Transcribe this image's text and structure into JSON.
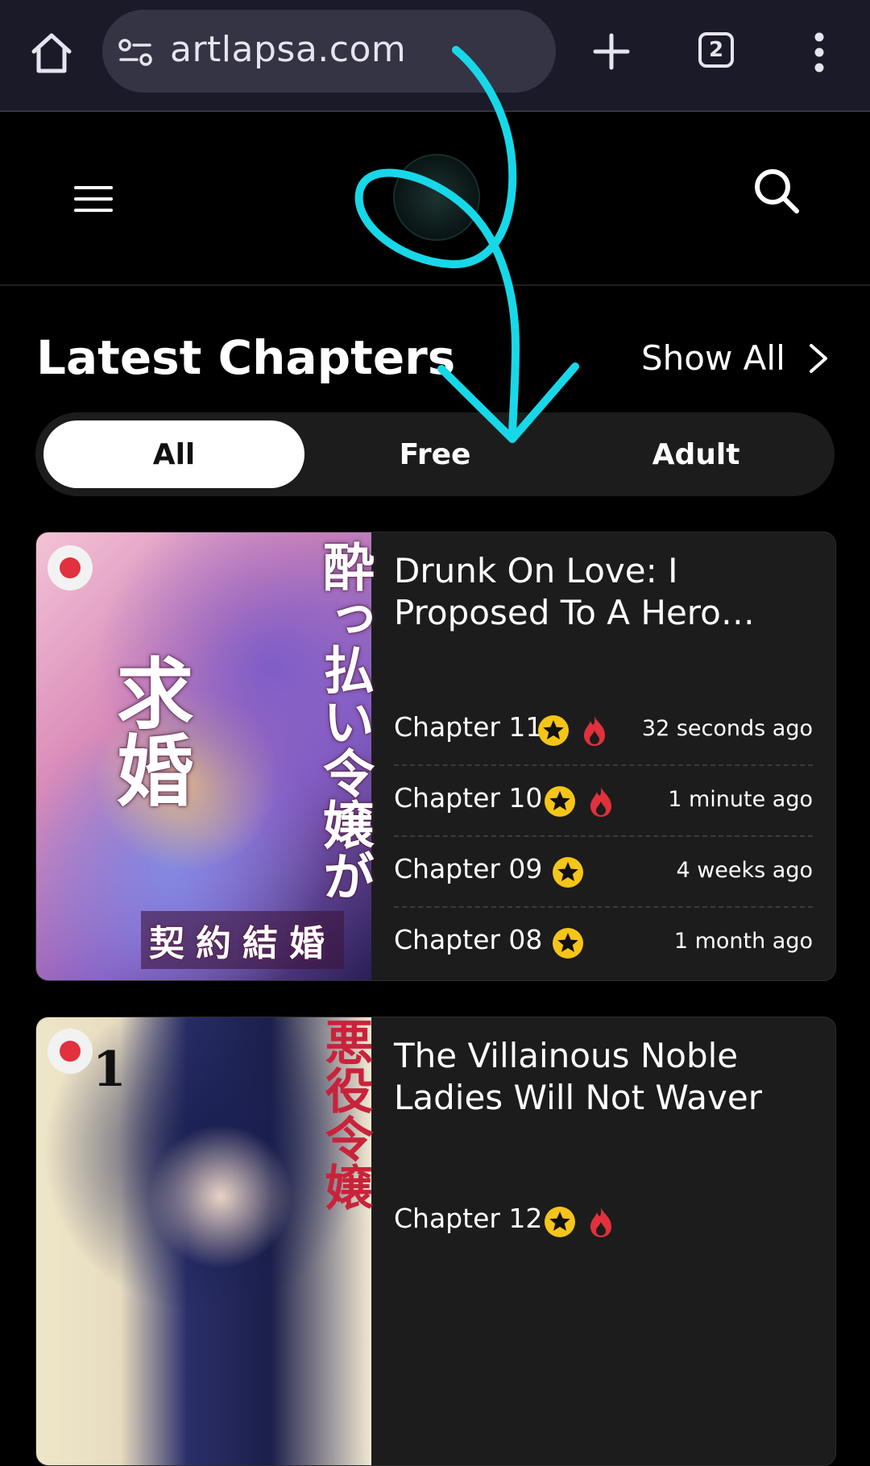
{
  "browser": {
    "url": "artlapsa.com",
    "tab_count": "2"
  },
  "section": {
    "title": "Latest Chapters",
    "show_all": "Show All"
  },
  "filters": [
    {
      "label": "All",
      "active": true
    },
    {
      "label": "Free",
      "active": false
    },
    {
      "label": "Adult",
      "active": false
    }
  ],
  "series": [
    {
      "title": "Drunk On Love: I Proposed To A Hero…",
      "cover_text": [
        "酔っ払い令嬢が",
        "求婚",
        "契約結婚"
      ],
      "chapters": [
        {
          "name": "Chapter 11",
          "time": "32 seconds ago",
          "premium": true,
          "hot": true
        },
        {
          "name": "Chapter 10",
          "time": "1 minute ago",
          "premium": true,
          "hot": true
        },
        {
          "name": "Chapter 09",
          "time": "4 weeks ago",
          "premium": true,
          "hot": false
        },
        {
          "name": "Chapter 08",
          "time": "1 month ago",
          "premium": true,
          "hot": false
        }
      ]
    },
    {
      "title": "The Villainous Noble Ladies Will Not Waver",
      "cover_text": [
        "悪役令嬢",
        "1"
      ],
      "chapters": [
        {
          "name": "Chapter 12",
          "time": "",
          "premium": true,
          "hot": true
        }
      ]
    }
  ],
  "colors": {
    "accent_star": "#f5c518",
    "fire": "#e0313d",
    "annotation": "#17d8e8"
  }
}
